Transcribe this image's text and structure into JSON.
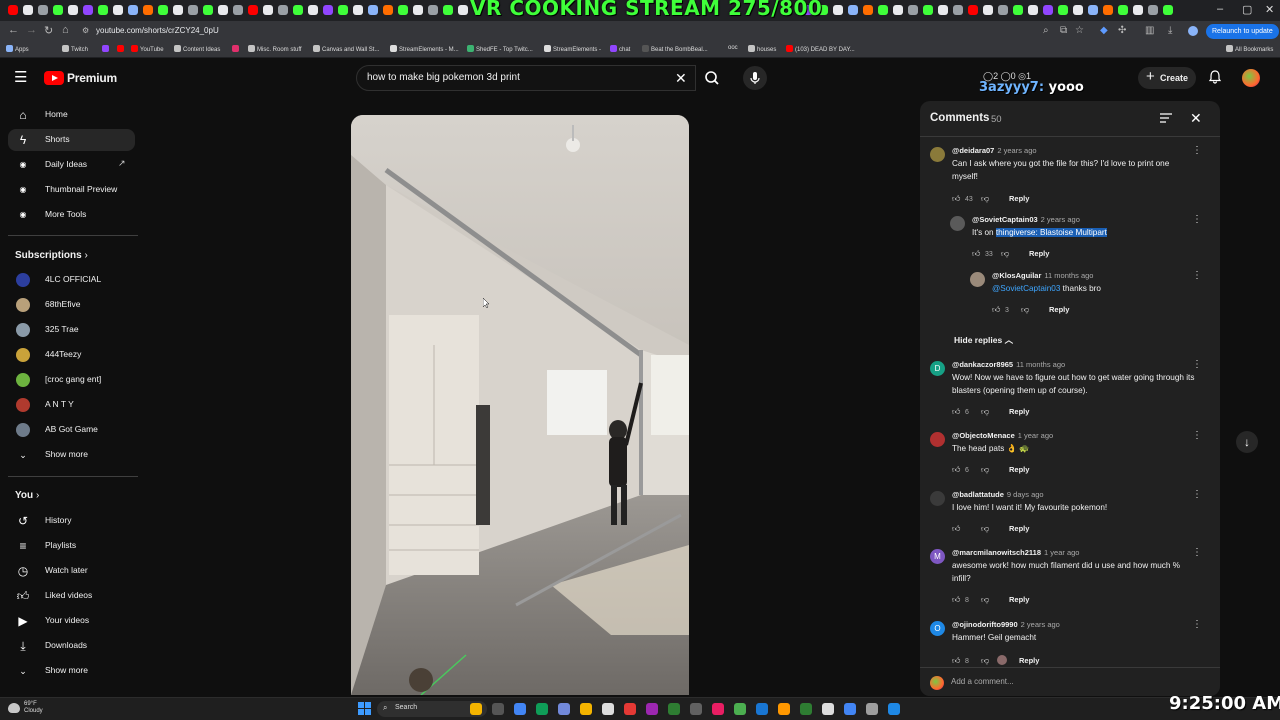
{
  "stream_overlay": {
    "title": "VR COOKING STREAM 275/800",
    "stats": "◯2 ◯0 ◎1",
    "chat_user": "3azyyy7:",
    "chat_message": "yooo"
  },
  "browser": {
    "url": "youtube.com/shorts/crZCY24_0pU",
    "relaunch_label": "Relaunch to update",
    "bookmarks": [
      "Apps",
      "Twitch",
      "YouTube",
      "Content Ideas",
      "Misc. Room stuff",
      "Canvas and Wall St...",
      "StreamElements - M...",
      "ShedFE - Top Twitc...",
      "StreamElements -",
      "chat",
      "Beat the BombBeal...",
      "ooc",
      "houses",
      "(103) DEAD BY DAY..."
    ],
    "all_bookmarks_label": "All Bookmarks"
  },
  "header": {
    "logo_text": "Premium",
    "search_value": "how to make big pokemon 3d print",
    "search_placeholder": "Search",
    "create_label": "Create"
  },
  "sidebar": {
    "main": [
      {
        "label": "Home",
        "icon": "home-icon"
      },
      {
        "label": "Shorts",
        "icon": "shorts-icon"
      },
      {
        "label": "Daily Ideas",
        "icon": "ideas-icon"
      },
      {
        "label": "Thumbnail Preview",
        "icon": "thumbnail-icon"
      },
      {
        "label": "More Tools",
        "icon": "tools-icon"
      }
    ],
    "subscriptions_heading": "Subscriptions",
    "subscriptions": [
      "4LC OFFICIAL",
      "68thEfive",
      "325 Trae",
      "444Teezy",
      "[croc gang ent]",
      "A N T Y",
      "AB Got Game"
    ],
    "show_more": "Show more",
    "you_heading": "You",
    "you_items": [
      {
        "label": "History",
        "icon": "history-icon"
      },
      {
        "label": "Playlists",
        "icon": "playlists-icon"
      },
      {
        "label": "Watch later",
        "icon": "watch-later-icon"
      },
      {
        "label": "Liked videos",
        "icon": "liked-icon"
      },
      {
        "label": "Your videos",
        "icon": "your-videos-icon"
      },
      {
        "label": "Downloads",
        "icon": "downloads-icon"
      }
    ],
    "show_more_2": "Show more"
  },
  "comments": {
    "title": "Comments",
    "count": "50",
    "hide_replies": "Hide replies",
    "add_placeholder": "Add a comment...",
    "items": [
      {
        "author": "@deidara07",
        "time": "2 years ago",
        "text": "Can I ask where you got the file for this?  I'd love to print one myself!",
        "likes": "43",
        "reply": "Reply",
        "avatar_color": "#8a7a3a"
      },
      {
        "author": "@SovietCaptain03",
        "time": "2 years ago",
        "text_prefix": "It's on ",
        "text_link": "thingiverse: Blastoise Multipart",
        "likes": "33",
        "reply": "Reply",
        "avatar_color": "#5a5a5a"
      },
      {
        "author": "@KlosAguilar",
        "time": "11 months ago",
        "text_mention": "@SovietCaptain03",
        "text_suffix": " thanks bro",
        "likes": "3",
        "reply": "Reply",
        "avatar_color": "#9a8a7a"
      },
      {
        "author": "@dankaczor8965",
        "time": "11 months ago",
        "text": "Wow! Now we have to figure out how to get water going through its blasters (opening them up of course).",
        "likes": "6",
        "reply": "Reply",
        "avatar_letter": "D",
        "avatar_color": "#16a085"
      },
      {
        "author": "@ObjectoMenace",
        "time": "1 year ago",
        "text": "The head pats 👌 🐢",
        "likes": "6",
        "reply": "Reply",
        "avatar_color": "#b03030"
      },
      {
        "author": "@badlattatude",
        "time": "9 days ago",
        "text": "I love him! I want it! My favourite pokemon!",
        "likes": "",
        "reply": "Reply",
        "avatar_color": "#3a3a3a"
      },
      {
        "author": "@marcmilanowitsch2118",
        "time": "1 year ago",
        "text": "awesome work! how much filament did u use and how much % infill?",
        "likes": "8",
        "reply": "Reply",
        "avatar_letter": "M",
        "avatar_color": "#7e57c2"
      },
      {
        "author": "@ojinodorifto9990",
        "time": "2 years ago",
        "text": "Hammer! Geil gemacht",
        "likes": "8",
        "reply": "Reply",
        "avatar_letter": "O",
        "avatar_color": "#1e88e5"
      }
    ]
  },
  "taskbar": {
    "weather_temp": "69°F",
    "weather_desc": "Cloudy",
    "search_label": "Search",
    "clock": "9:25:00 AM"
  }
}
